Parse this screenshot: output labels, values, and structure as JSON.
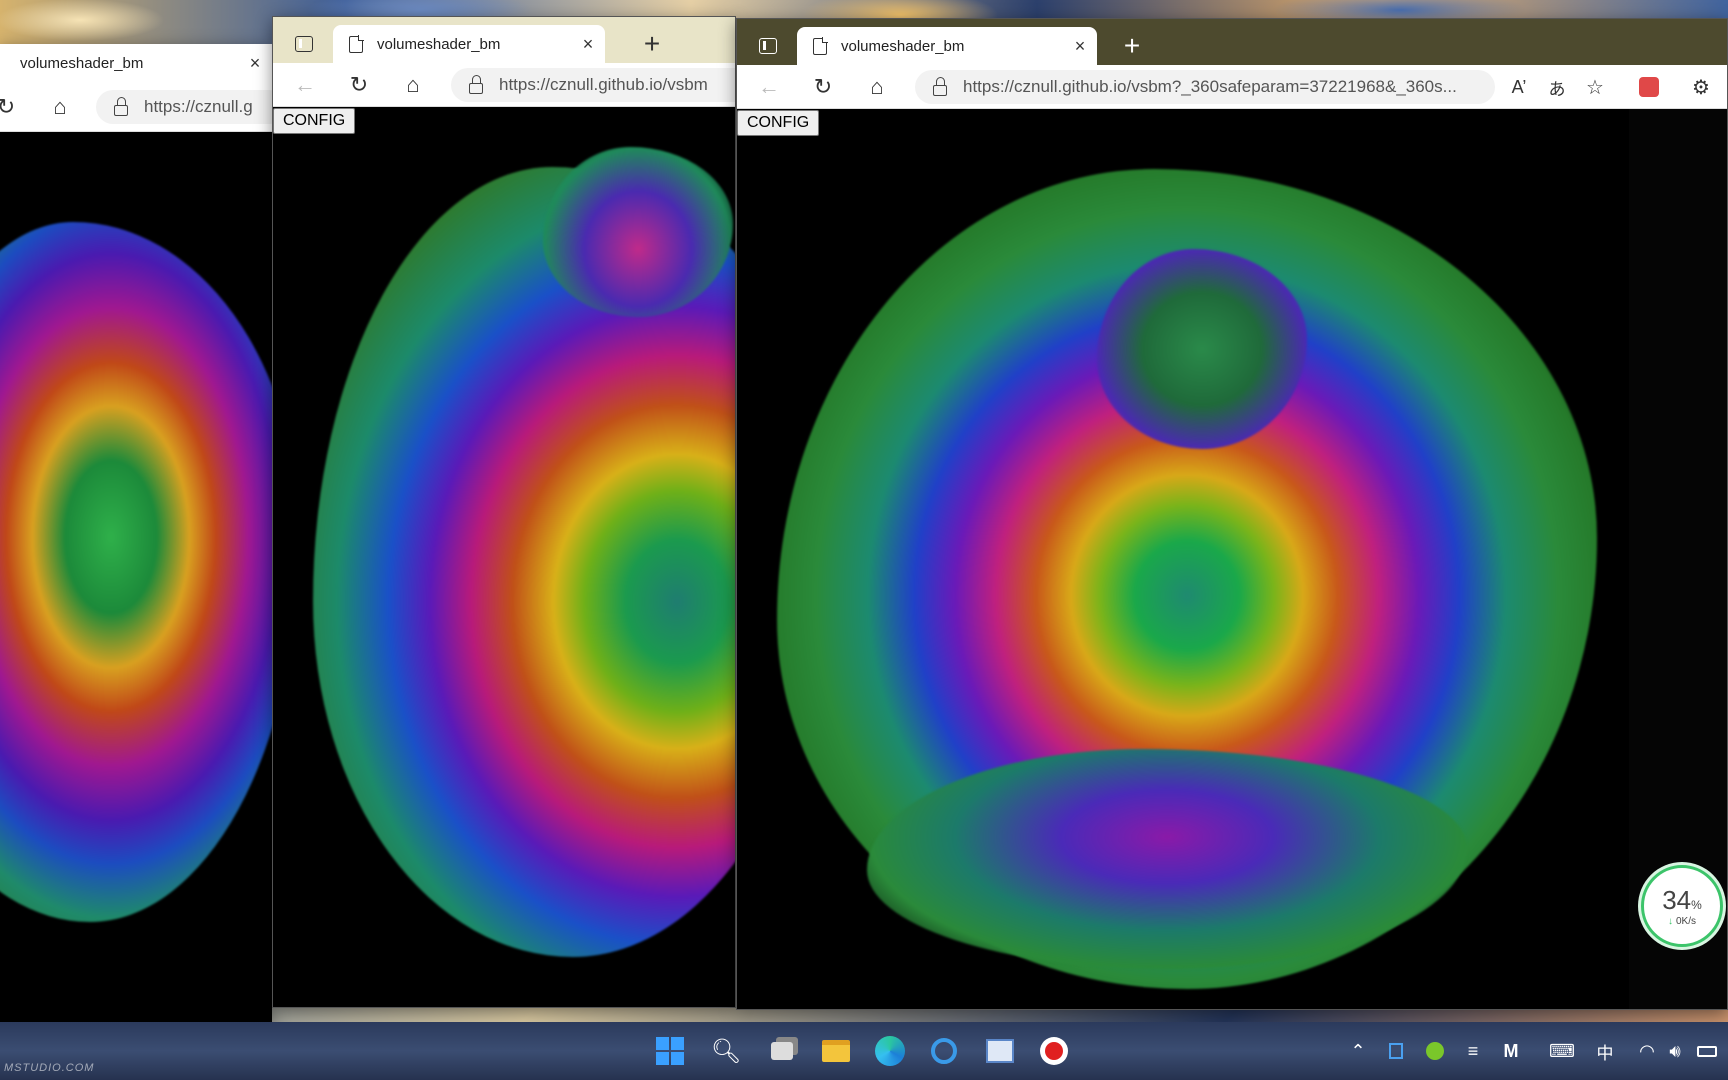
{
  "windows": {
    "left": {
      "tab_title": "volumeshader_bm",
      "tab_close": "×",
      "address": "https://cznull.g"
    },
    "middle": {
      "tab_title": "volumeshader_bm",
      "tab_close": "×",
      "new_tab": "+",
      "address": "https://cznull.github.io/vsbm",
      "config_label": "CONFIG"
    },
    "right": {
      "tab_title": "volumeshader_bm",
      "tab_close": "×",
      "new_tab": "+",
      "address": "https://cznull.github.io/vsbm?_360safeparam=37221968&_360s...",
      "config_label": "CONFIG"
    }
  },
  "net_monitor": {
    "percent": "34",
    "percent_unit": "%",
    "speed": "0K/s"
  },
  "taskbar": {
    "tray": {
      "ime_label": "中"
    }
  },
  "watermark": "MSTUDIO.COM",
  "colors": {
    "tabstrip_dark": "#5a5632",
    "tabstrip_mid": "#3a3c2a",
    "netmon_accent": "#3cc46a"
  }
}
